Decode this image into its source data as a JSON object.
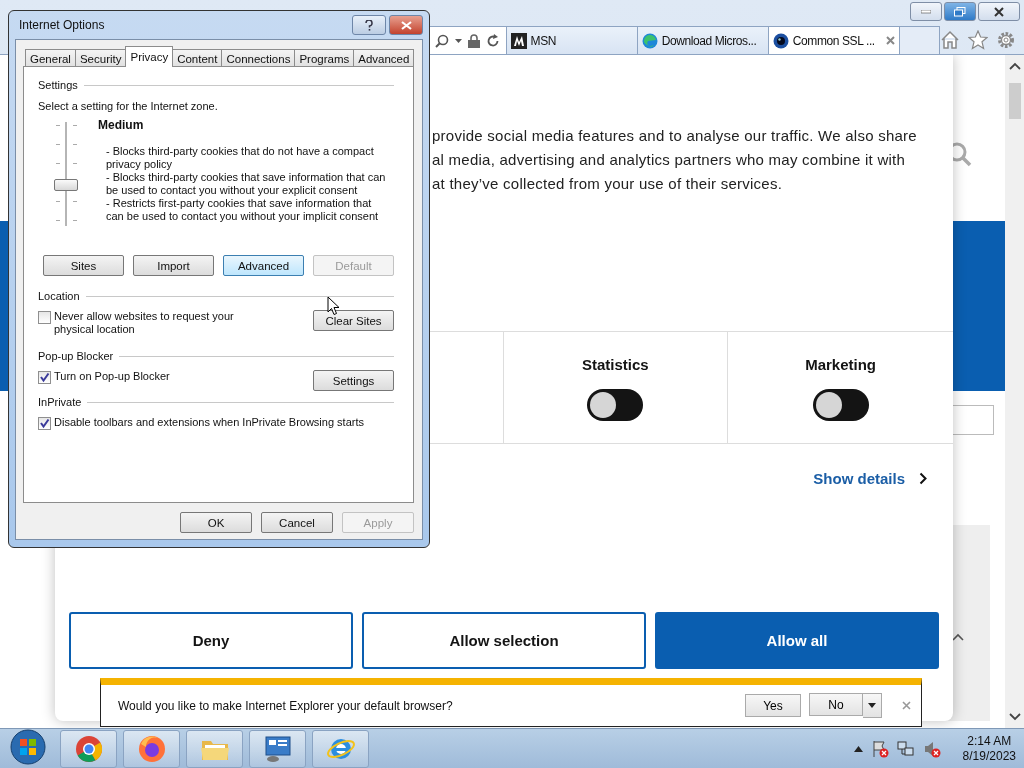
{
  "browser": {
    "tabs": [
      {
        "label": "MSN",
        "selected": false
      },
      {
        "label": "Download Micros...",
        "selected": false
      },
      {
        "label": "Common SSL ...",
        "selected": true
      }
    ]
  },
  "consent": {
    "text_lines": [
      "provide social media features and to analyse our traffic. We also share",
      "al media, advertising and analytics partners who may combine it with",
      "at they’ve collected from your use of their services."
    ],
    "categories": [
      {
        "label": "Statistics",
        "on": false
      },
      {
        "label": "Marketing",
        "on": false
      }
    ],
    "details_link": "Show details",
    "buttons": [
      {
        "label": "Deny",
        "kind": "outline"
      },
      {
        "label": "Allow selection",
        "kind": "outline"
      },
      {
        "label": "Allow all",
        "kind": "filled"
      }
    ]
  },
  "notification": {
    "message": "Would you like to make Internet Explorer your default browser?",
    "buttons": [
      "Yes",
      "No"
    ]
  },
  "dialog": {
    "title": "Internet Options",
    "tabs": [
      {
        "label": "General",
        "selected": false
      },
      {
        "label": "Security",
        "selected": false
      },
      {
        "label": "Privacy",
        "selected": true
      },
      {
        "label": "Content",
        "selected": false
      },
      {
        "label": "Connections",
        "selected": false
      },
      {
        "label": "Programs",
        "selected": false
      },
      {
        "label": "Advanced",
        "selected": false
      }
    ],
    "settings": {
      "heading": "Settings",
      "instruction": "Select a setting for the Internet zone.",
      "level_name": "Medium",
      "level": 0.4,
      "description": [
        "- Blocks third-party cookies that do not have a compact privacy policy",
        "- Blocks third-party cookies that save information that can be used to contact you without your explicit consent",
        "- Restricts first-party cookies that save information that can be used to contact you without your implicit consent"
      ]
    },
    "settings_buttons": [
      {
        "label": "Sites",
        "disabled": false,
        "focused": false
      },
      {
        "label": "Import",
        "disabled": false,
        "focused": false
      },
      {
        "label": "Advanced",
        "disabled": false,
        "focused": true
      },
      {
        "label": "Default",
        "disabled": true,
        "focused": false
      }
    ],
    "sections": [
      {
        "heading": "Location",
        "options": [
          {
            "label": "Never allow websites to request your physical location",
            "checked": false
          }
        ],
        "button": "Clear Sites"
      },
      {
        "heading": "Pop-up Blocker",
        "options": [
          {
            "label": "Turn on Pop-up Blocker",
            "checked": true
          }
        ],
        "button": "Settings"
      },
      {
        "heading": "InPrivate",
        "options": [
          {
            "label": "Disable toolbars and extensions when InPrivate Browsing starts",
            "checked": true
          }
        ]
      }
    ],
    "footer_buttons": [
      {
        "label": "OK",
        "disabled": false
      },
      {
        "label": "Cancel",
        "disabled": false
      },
      {
        "label": "Apply",
        "disabled": true
      }
    ]
  },
  "taskbar": {
    "time": "2:14 AM",
    "date": "8/19/2023"
  }
}
